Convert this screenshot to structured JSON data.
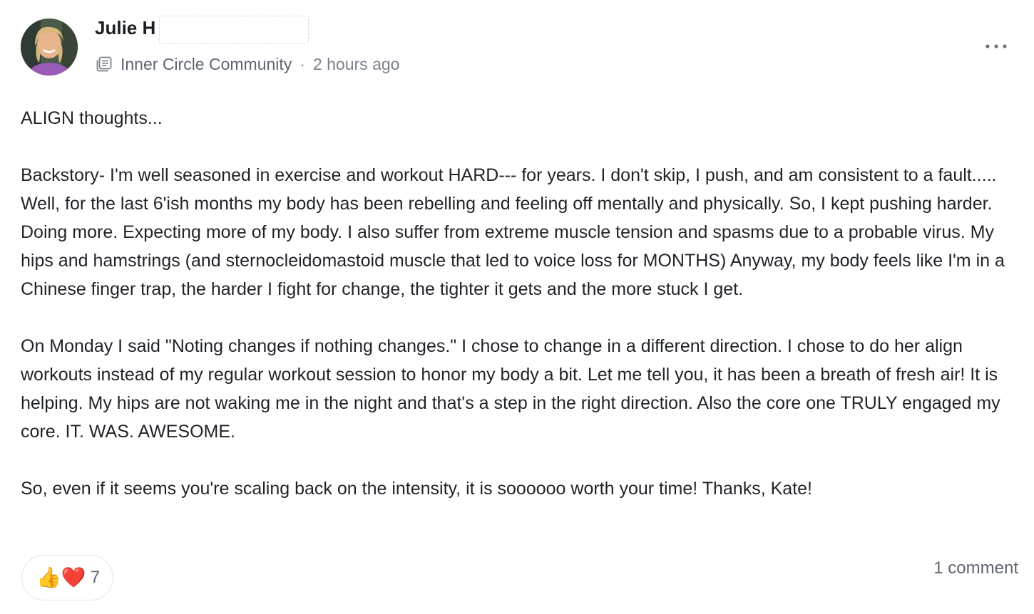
{
  "post": {
    "author_name": "Julie H",
    "space_name": "Inner Circle Community",
    "separator": "·",
    "timestamp": "2 hours ago",
    "body": [
      "ALIGN thoughts...",
      "Backstory- I'm well seasoned in exercise and workout HARD--- for years. I don't skip, I push, and am consistent to a fault..... Well, for the last 6'ish months my body has been rebelling and feeling off mentally and physically. So, I kept pushing harder. Doing more. Expecting more of my body.  I also suffer from extreme muscle tension and spasms due to a probable virus. My hips and hamstrings (and sternocleidomastoid muscle that led to voice loss for MONTHS) Anyway, my body feels like I'm in a Chinese finger trap, the harder I fight for change, the tighter it gets and the more stuck I get.",
      "On Monday I said \"Noting changes if nothing changes.\" I chose to change in a different direction.  I chose to do her align workouts instead of my regular workout session to honor my body a bit. Let me tell you, it has been a breath of fresh air! It is helping. My hips are not waking me in the night and that's a step in the right direction. Also the core one TRULY engaged my core. IT. WAS. AWESOME.",
      "So, even if it seems you're scaling back on the intensity, it is soooooo worth your time! Thanks, Kate!"
    ],
    "reactions": {
      "emojis": [
        "👍",
        "❤️"
      ],
      "count": "7"
    },
    "comments_label": "1 comment"
  },
  "icons": {
    "space": "space-feed-icon",
    "more": "more-horizontal-icon"
  }
}
